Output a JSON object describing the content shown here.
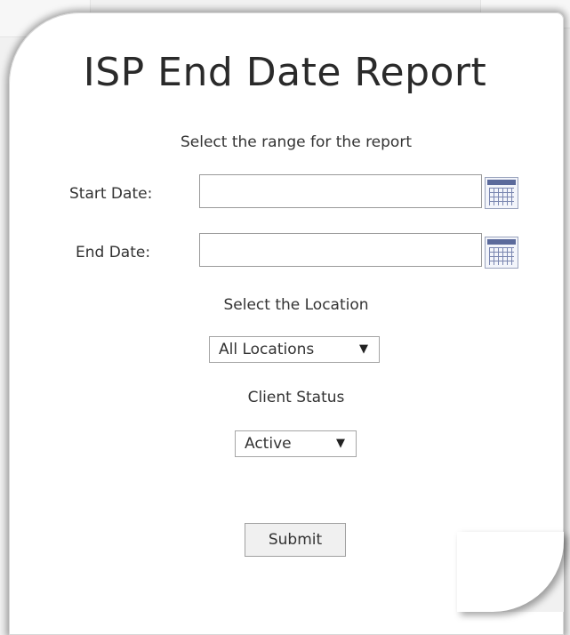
{
  "form": {
    "title": "ISP End Date Report",
    "range_prompt": "Select the range for the report",
    "start_date": {
      "label": "Start Date:",
      "value": ""
    },
    "end_date": {
      "label": "End Date:",
      "value": ""
    },
    "location": {
      "prompt": "Select the Location",
      "selected": "All Locations"
    },
    "client_status": {
      "prompt": "Client Status",
      "selected": "Active"
    },
    "submit_label": "Submit"
  },
  "icons": {
    "calendar": "calendar-icon",
    "dropdown": "triangle-down"
  }
}
